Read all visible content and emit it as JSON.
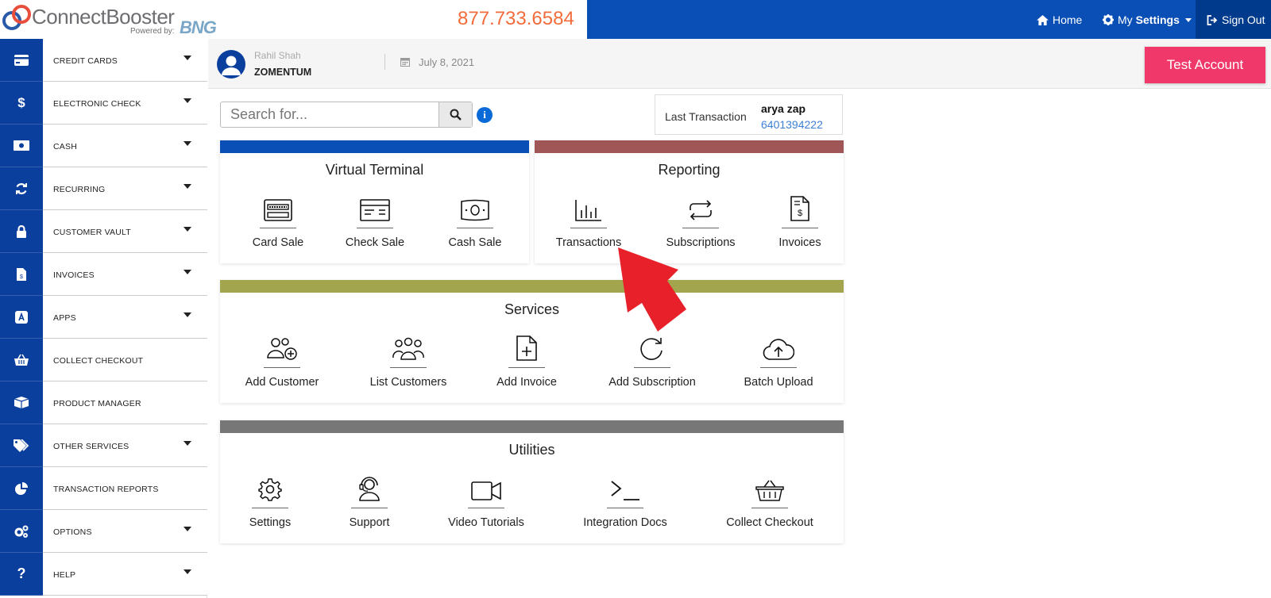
{
  "header": {
    "logo_text": "ConnectBooster",
    "powered_by": "Powered by:",
    "gateway_text": "BNG",
    "phone": "877.733.6584",
    "nav": {
      "home": "Home",
      "settings_prefix": "My",
      "settings_bold": "Settings",
      "sign_out": "Sign Out"
    }
  },
  "sidebar": {
    "items": [
      {
        "label": "CREDIT CARDS",
        "icon": "credit-card-icon"
      },
      {
        "label": "ELECTRONIC CHECK",
        "icon": "dollar-icon"
      },
      {
        "label": "CASH",
        "icon": "cash-icon"
      },
      {
        "label": "RECURRING",
        "icon": "refresh-icon"
      },
      {
        "label": "CUSTOMER VAULT",
        "icon": "lock-icon"
      },
      {
        "label": "INVOICES",
        "icon": "invoice-icon"
      },
      {
        "label": "APPS",
        "icon": "app-store-icon"
      },
      {
        "label": "COLLECT CHECKOUT",
        "icon": "basket-icon"
      },
      {
        "label": "PRODUCT MANAGER",
        "icon": "box-icon"
      },
      {
        "label": "OTHER SERVICES",
        "icon": "tags-icon"
      },
      {
        "label": "TRANSACTION REPORTS",
        "icon": "pie-chart-icon"
      },
      {
        "label": "OPTIONS",
        "icon": "gears-icon"
      },
      {
        "label": "HELP",
        "icon": "question-icon"
      }
    ]
  },
  "subheader": {
    "user_name": "Rahil Shah",
    "company": "ZOMENTUM",
    "date": "July 8, 2021",
    "test_account": "Test Account"
  },
  "search": {
    "placeholder": "Search for..."
  },
  "last_transaction": {
    "label": "Last Transaction",
    "name": "arya zap",
    "number": "6401394222"
  },
  "virtual_terminal": {
    "title": "Virtual Terminal",
    "color": "#0a4fb6",
    "tiles": [
      "Card Sale",
      "Check Sale",
      "Cash Sale"
    ]
  },
  "reporting": {
    "title": "Reporting",
    "color": "#a05656",
    "tiles": [
      "Transactions",
      "Subscriptions",
      "Invoices"
    ]
  },
  "services": {
    "title": "Services",
    "color": "#a3a44e",
    "tiles": [
      "Add Customer",
      "List Customers",
      "Add Invoice",
      "Add Subscription",
      "Batch Upload"
    ]
  },
  "utilities": {
    "title": "Utilities",
    "color": "#777777",
    "tiles": [
      "Settings",
      "Support",
      "Video Tutorials",
      "Integration Docs",
      "Collect Checkout"
    ]
  }
}
